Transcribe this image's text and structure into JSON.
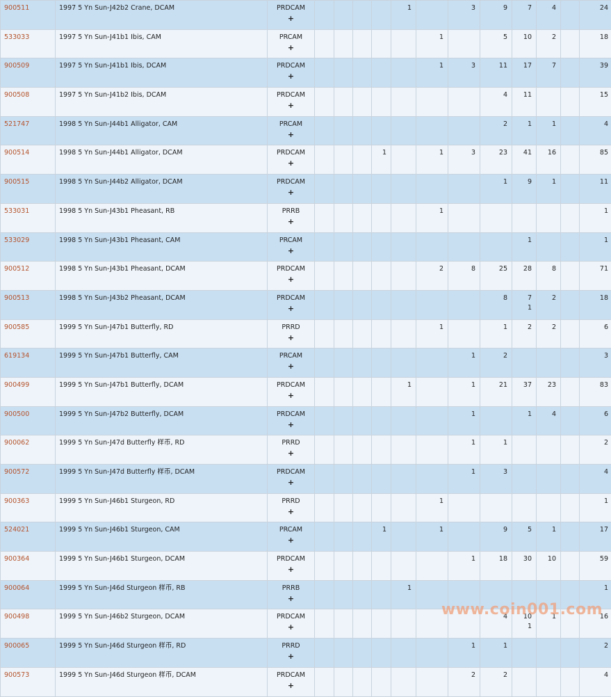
{
  "rows": [
    {
      "id": "900511",
      "desc": "1997 5 Yn Sun-J42b2 Crane, DCAM",
      "desig": "PRDCAM",
      "plus": "+",
      "grades": [
        "",
        "",
        "",
        "",
        "1",
        "",
        "3",
        "9",
        "7",
        "4",
        "",
        ""
      ],
      "total": "24"
    },
    {
      "id": "533033",
      "desc": "1997 5 Yn Sun-J41b1 Ibis, CAM",
      "desig": "PRCAM",
      "plus": "+",
      "grades": [
        "",
        "",
        "",
        "",
        "",
        "1",
        "",
        "5",
        "10",
        "2",
        "",
        ""
      ],
      "total": "18"
    },
    {
      "id": "900509",
      "desc": "1997 5 Yn Sun-J41b1 Ibis, DCAM",
      "desig": "PRDCAM",
      "plus": "+",
      "grades": [
        "",
        "",
        "",
        "",
        "",
        "1",
        "3",
        "11",
        "17",
        "7",
        "",
        ""
      ],
      "total": "39"
    },
    {
      "id": "900508",
      "desc": "1997 5 Yn Sun-J41b2 Ibis, DCAM",
      "desig": "PRDCAM",
      "plus": "+",
      "grades": [
        "",
        "",
        "",
        "",
        "",
        "",
        "",
        "4",
        "11",
        "",
        "",
        ""
      ],
      "total": "15"
    },
    {
      "id": "521747",
      "desc": "1998 5 Yn Sun-J44b1 Alligator, CAM",
      "desig": "PRCAM",
      "plus": "+",
      "grades": [
        "",
        "",
        "",
        "",
        "",
        "",
        "",
        "2",
        "1",
        "1",
        "",
        ""
      ],
      "total": "4"
    },
    {
      "id": "900514",
      "desc": "1998 5 Yn Sun-J44b1 Alligator, DCAM",
      "desig": "PRDCAM",
      "plus": "+",
      "grades": [
        "",
        "",
        "",
        "1",
        "",
        "1",
        "3",
        "23",
        "41",
        "16",
        "",
        ""
      ],
      "total": "85"
    },
    {
      "id": "900515",
      "desc": "1998 5 Yn Sun-J44b2 Alligator, DCAM",
      "desig": "PRDCAM",
      "plus": "+",
      "grades": [
        "",
        "",
        "",
        "",
        "",
        "",
        "",
        "1",
        "9",
        "1",
        "",
        ""
      ],
      "total": "11"
    },
    {
      "id": "533031",
      "desc": "1998 5 Yn Sun-J43b1 Pheasant, RB",
      "desig": "PRRB",
      "plus": "+",
      "grades": [
        "",
        "",
        "",
        "",
        "",
        "1",
        "",
        "",
        "",
        "",
        "",
        ""
      ],
      "total": "1"
    },
    {
      "id": "533029",
      "desc": "1998 5 Yn Sun-J43b1 Pheasant, CAM",
      "desig": "PRCAM",
      "plus": "+",
      "grades": [
        "",
        "",
        "",
        "",
        "",
        "",
        "",
        "",
        "1",
        "",
        "",
        ""
      ],
      "total": "1"
    },
    {
      "id": "900512",
      "desc": "1998 5 Yn Sun-J43b1 Pheasant, DCAM",
      "desig": "PRDCAM",
      "plus": "+",
      "grades": [
        "",
        "",
        "",
        "",
        "",
        "2",
        "8",
        "25",
        "28",
        "8",
        "",
        ""
      ],
      "total": "71"
    },
    {
      "id": "900513",
      "desc": "1998 5 Yn Sun-J43b2 Pheasant, DCAM",
      "desig": "PRDCAM",
      "plus": "+",
      "grades": [
        "",
        "",
        "",
        "",
        "",
        "",
        "",
        "8",
        "7",
        "2",
        "",
        ""
      ],
      "sub": [
        "",
        "",
        "",
        "",
        "",
        "",
        "",
        "",
        "1",
        "",
        "",
        ""
      ],
      "total": "18"
    },
    {
      "id": "900585",
      "desc": "1999 5 Yn Sun-J47b1 Butterfly, RD",
      "desig": "PRRD",
      "plus": "+",
      "grades": [
        "",
        "",
        "",
        "",
        "",
        "1",
        "",
        "1",
        "2",
        "2",
        "",
        ""
      ],
      "total": "6"
    },
    {
      "id": "619134",
      "desc": "1999 5 Yn Sun-J47b1 Butterfly, CAM",
      "desig": "PRCAM",
      "plus": "+",
      "grades": [
        "",
        "",
        "",
        "",
        "",
        "",
        "1",
        "2",
        "",
        "",
        "",
        ""
      ],
      "total": "3"
    },
    {
      "id": "900499",
      "desc": "1999 5 Yn Sun-J47b1 Butterfly, DCAM",
      "desig": "PRDCAM",
      "plus": "+",
      "grades": [
        "",
        "",
        "",
        "",
        "1",
        "",
        "1",
        "21",
        "37",
        "23",
        "",
        ""
      ],
      "total": "83"
    },
    {
      "id": "900500",
      "desc": "1999 5 Yn Sun-J47b2 Butterfly, DCAM",
      "desig": "PRDCAM",
      "plus": "+",
      "grades": [
        "",
        "",
        "",
        "",
        "",
        "",
        "1",
        "",
        "1",
        "4",
        "",
        ""
      ],
      "total": "6"
    },
    {
      "id": "900062",
      "desc": "1999 5 Yn Sun-J47d Butterfly 样币, RD",
      "desig": "PRRD",
      "plus": "+",
      "grades": [
        "",
        "",
        "",
        "",
        "",
        "",
        "1",
        "1",
        "",
        "",
        "",
        ""
      ],
      "total": "2"
    },
    {
      "id": "900572",
      "desc": "1999 5 Yn Sun-J47d Butterfly 样币, DCAM",
      "desig": "PRDCAM",
      "plus": "+",
      "grades": [
        "",
        "",
        "",
        "",
        "",
        "",
        "1",
        "3",
        "",
        "",
        "",
        ""
      ],
      "total": "4"
    },
    {
      "id": "900363",
      "desc": "1999 5 Yn Sun-J46b1 Sturgeon, RD",
      "desig": "PRRD",
      "plus": "+",
      "grades": [
        "",
        "",
        "",
        "",
        "",
        "1",
        "",
        "",
        "",
        "",
        "",
        ""
      ],
      "total": "1"
    },
    {
      "id": "524021",
      "desc": "1999 5 Yn Sun-J46b1 Sturgeon, CAM",
      "desig": "PRCAM",
      "plus": "+",
      "grades": [
        "",
        "",
        "",
        "1",
        "",
        "1",
        "",
        "9",
        "5",
        "1",
        "",
        ""
      ],
      "total": "17"
    },
    {
      "id": "900364",
      "desc": "1999 5 Yn Sun-J46b1 Sturgeon, DCAM",
      "desig": "PRDCAM",
      "plus": "+",
      "grades": [
        "",
        "",
        "",
        "",
        "",
        "",
        "1",
        "18",
        "30",
        "10",
        "",
        ""
      ],
      "total": "59"
    },
    {
      "id": "900064",
      "desc": "1999 5 Yn Sun-J46d Sturgeon 样币, RB",
      "desig": "PRRB",
      "plus": "+",
      "grades": [
        "",
        "",
        "",
        "",
        "1",
        "",
        "",
        "",
        "",
        "",
        "",
        ""
      ],
      "total": "1"
    },
    {
      "id": "900498",
      "desc": "1999 5 Yn Sun-J46b2 Sturgeon, DCAM",
      "desig": "PRDCAM",
      "plus": "+",
      "grades": [
        "",
        "",
        "",
        "",
        "",
        "",
        "",
        "4",
        "10",
        "1",
        "",
        ""
      ],
      "sub": [
        "",
        "",
        "",
        "",
        "",
        "",
        "",
        "",
        "1",
        "",
        "",
        ""
      ],
      "total": "16"
    },
    {
      "id": "900065",
      "desc": "1999 5 Yn Sun-J46d Sturgeon 样币, RD",
      "desig": "PRRD",
      "plus": "+",
      "grades": [
        "",
        "",
        "",
        "",
        "",
        "",
        "1",
        "1",
        "",
        "",
        "",
        ""
      ],
      "total": "2"
    },
    {
      "id": "900573",
      "desc": "1999 5 Yn Sun-J46d Sturgeon 样币, DCAM",
      "desig": "PRDCAM",
      "plus": "+",
      "grades": [
        "",
        "",
        "",
        "",
        "",
        "",
        "2",
        "2",
        "",
        "",
        "",
        ""
      ],
      "total": "4"
    }
  ],
  "watermark": "www.coin001.com",
  "colors": {
    "link": "#b5522a",
    "row_odd": "#c8dff2",
    "row_even": "#eef4fa",
    "border": "#c9d3dd",
    "watermark": "#f0a07a"
  }
}
